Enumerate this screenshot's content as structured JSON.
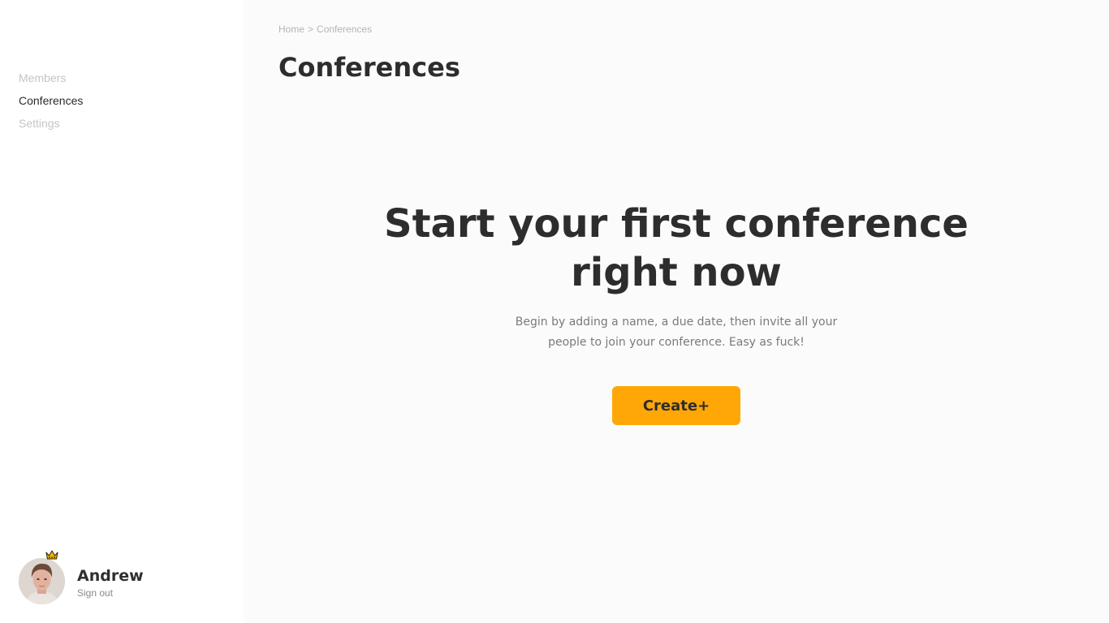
{
  "sidebar": {
    "nav": [
      {
        "label": "Members",
        "active": false
      },
      {
        "label": "Conferences",
        "active": true
      },
      {
        "label": "Settings",
        "active": false
      }
    ],
    "user": {
      "name": "Andrew",
      "sign_out_label": "Sign out",
      "badge_icon": "crown-icon",
      "badge_color": "#f2b705"
    }
  },
  "header": {
    "breadcrumb": {
      "home": "Home",
      "separator": ">",
      "current": "Conferences"
    },
    "title": "Conferences"
  },
  "empty_state": {
    "title": "Start your first conference right now",
    "description": "Begin by adding a name, a due date, then invite all your people to join your conference. Easy as fuck!",
    "button_label": "Create+"
  },
  "colors": {
    "accent": "#ffa707",
    "text_dark": "#2d2d2d",
    "text_muted": "#c4c4c4",
    "main_background": "#fbfbfb"
  }
}
